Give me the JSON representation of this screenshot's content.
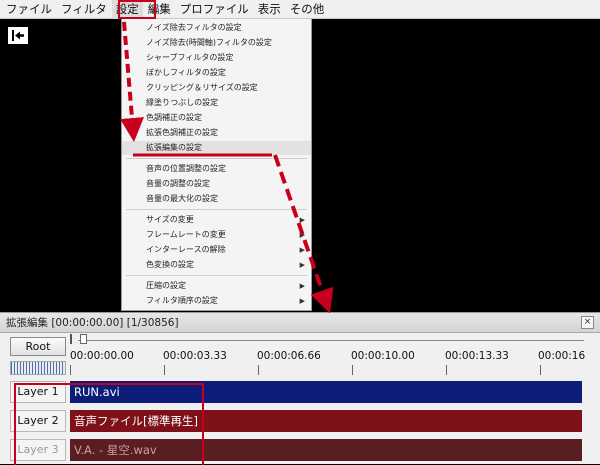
{
  "menubar": {
    "items": [
      "ファイル",
      "フィルタ",
      "設定",
      "編集",
      "プロファイル",
      "表示",
      "その他"
    ]
  },
  "dropdown": {
    "items": [
      {
        "label": "ノイズ除去フィルタの設定",
        "submenu": false
      },
      {
        "label": "ノイズ除去(時間軸)フィルタの設定",
        "submenu": false
      },
      {
        "label": "シャープフィルタの設定",
        "submenu": false
      },
      {
        "label": "ぼかしフィルタの設定",
        "submenu": false
      },
      {
        "label": "クリッピング＆リサイズの設定",
        "submenu": false
      },
      {
        "label": "縁塗りつぶしの設定",
        "submenu": false
      },
      {
        "label": "色調補正の設定",
        "submenu": false
      },
      {
        "label": "拡張色調補正の設定",
        "submenu": false
      },
      {
        "label": "拡張編集の設定",
        "submenu": false
      },
      {
        "label": "音声の位置調整の設定",
        "submenu": false
      },
      {
        "label": "音量の調整の設定",
        "submenu": false
      },
      {
        "label": "音量の最大化の設定",
        "submenu": false
      },
      {
        "label": "サイズの変更",
        "submenu": true
      },
      {
        "label": "フレームレートの変更",
        "submenu": true
      },
      {
        "label": "インターレースの解除",
        "submenu": true
      },
      {
        "label": "色変換の設定",
        "submenu": true
      },
      {
        "label": "圧縮の設定",
        "submenu": true
      },
      {
        "label": "フィルタ順序の設定",
        "submenu": true
      }
    ]
  },
  "ext_window": {
    "title": "拡張編集 [00:00:00.00] [1/30856]",
    "close": "×",
    "root_label": "Root",
    "ruler": [
      "00:00:00.00",
      "00:00:03.33",
      "00:00:06.66",
      "00:00:10.00",
      "00:00:13.33",
      "00:00:16"
    ],
    "layers": [
      {
        "label": "Layer 1",
        "clip": "RUN.avi",
        "color": "#0c1c78"
      },
      {
        "label": "Layer 2",
        "clip": "音声ファイル[標準再生]",
        "color": "#7d1018"
      },
      {
        "label": "Layer 3",
        "clip": "V.A. - 星空.wav",
        "color": "#5a1e22"
      }
    ]
  },
  "annotation_color": "#c8001e"
}
